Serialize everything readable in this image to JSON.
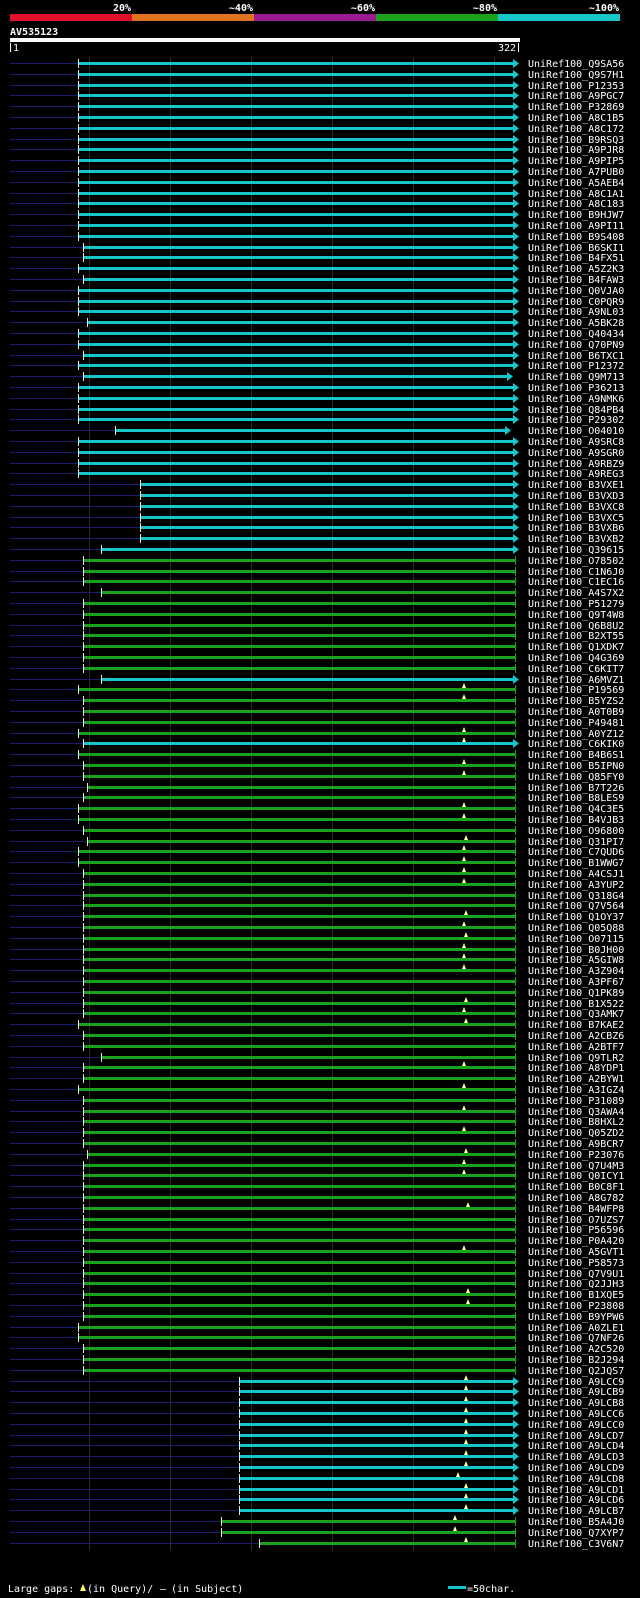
{
  "title": "AV535123",
  "scale": {
    "labels": [
      "20%",
      "~40%",
      "~60%",
      "~80%",
      "~100%"
    ],
    "colors": [
      "#e0102c",
      "#e2731e",
      "#9a1b8f",
      "#1ca11c",
      "#17c6c8"
    ]
  },
  "ruler": {
    "start": "1",
    "end": "322"
  },
  "legend": {
    "prefix": "Large gaps:",
    "query_text": "(in Query)/",
    "dash": "–",
    "subject_text": "(in Subject)",
    "scale_text": "=50char."
  },
  "colors": {
    "cyan": "#17c6c8",
    "green": "#1ca11c",
    "navy": "#1a1a6e",
    "gridline": "#2b2b2b",
    "white_bar": "#ffffff"
  },
  "hits": [
    {
      "id": "UniRef100_Q9SA56",
      "s": 78,
      "e": 516,
      "c": "cyan"
    },
    {
      "id": "UniRef100_Q9S7H1",
      "s": 78,
      "e": 516,
      "c": "cyan"
    },
    {
      "id": "UniRef100_P12353",
      "s": 78,
      "e": 516,
      "c": "cyan"
    },
    {
      "id": "UniRef100_A9PGC7",
      "s": 78,
      "e": 516,
      "c": "cyan"
    },
    {
      "id": "UniRef100_P32869",
      "s": 78,
      "e": 516,
      "c": "cyan"
    },
    {
      "id": "UniRef100_A8C1B5",
      "s": 78,
      "e": 516,
      "c": "cyan"
    },
    {
      "id": "UniRef100_A8C172",
      "s": 78,
      "e": 516,
      "c": "cyan"
    },
    {
      "id": "UniRef100_B9RSQ3",
      "s": 78,
      "e": 516,
      "c": "cyan"
    },
    {
      "id": "UniRef100_A9PJR8",
      "s": 78,
      "e": 516,
      "c": "cyan"
    },
    {
      "id": "UniRef100_A9PIP5",
      "s": 78,
      "e": 516,
      "c": "cyan"
    },
    {
      "id": "UniRef100_A7PUB0",
      "s": 78,
      "e": 516,
      "c": "cyan"
    },
    {
      "id": "UniRef100_A5AEB4",
      "s": 78,
      "e": 516,
      "c": "cyan"
    },
    {
      "id": "UniRef100_A8C1A1",
      "s": 78,
      "e": 516,
      "c": "cyan"
    },
    {
      "id": "UniRef100_A8C183",
      "s": 78,
      "e": 516,
      "c": "cyan"
    },
    {
      "id": "UniRef100_B9HJW7",
      "s": 78,
      "e": 516,
      "c": "cyan"
    },
    {
      "id": "UniRef100_A9PI11",
      "s": 78,
      "e": 516,
      "c": "cyan"
    },
    {
      "id": "UniRef100_B9S408",
      "s": 78,
      "e": 516,
      "c": "cyan"
    },
    {
      "id": "UniRef100_B6SKI1",
      "s": 83,
      "e": 516,
      "c": "cyan"
    },
    {
      "id": "UniRef100_B4FX51",
      "s": 83,
      "e": 516,
      "c": "cyan"
    },
    {
      "id": "UniRef100_A5Z2K3",
      "s": 78,
      "e": 516,
      "c": "cyan"
    },
    {
      "id": "UniRef100_B4FAW3",
      "s": 83,
      "e": 516,
      "c": "cyan"
    },
    {
      "id": "UniRef100_Q0VJA0",
      "s": 78,
      "e": 516,
      "c": "cyan"
    },
    {
      "id": "UniRef100_C0PQR9",
      "s": 78,
      "e": 516,
      "c": "cyan"
    },
    {
      "id": "UniRef100_A9NL03",
      "s": 78,
      "e": 516,
      "c": "cyan"
    },
    {
      "id": "UniRef100_A5BK28",
      "s": 87,
      "e": 516,
      "c": "cyan"
    },
    {
      "id": "UniRef100_Q40434",
      "s": 78,
      "e": 516,
      "c": "cyan"
    },
    {
      "id": "UniRef100_Q70PN9",
      "s": 78,
      "e": 516,
      "c": "cyan"
    },
    {
      "id": "UniRef100_B6TXC1",
      "s": 83,
      "e": 516,
      "c": "cyan"
    },
    {
      "id": "UniRef100_P12372",
      "s": 78,
      "e": 516,
      "c": "cyan"
    },
    {
      "id": "UniRef100_Q9M713",
      "s": 83,
      "e": 510,
      "c": "cyan"
    },
    {
      "id": "UniRef100_P36213",
      "s": 78,
      "e": 516,
      "c": "cyan"
    },
    {
      "id": "UniRef100_A9NMK6",
      "s": 78,
      "e": 516,
      "c": "cyan"
    },
    {
      "id": "UniRef100_Q84PB4",
      "s": 78,
      "e": 516,
      "c": "cyan"
    },
    {
      "id": "UniRef100_P29302",
      "s": 78,
      "e": 516,
      "c": "cyan"
    },
    {
      "id": "UniRef100_O04010",
      "s": 115,
      "e": 508,
      "c": "cyan"
    },
    {
      "id": "UniRef100_A9SRC8",
      "s": 78,
      "e": 516,
      "c": "cyan"
    },
    {
      "id": "UniRef100_A9SGR0",
      "s": 78,
      "e": 516,
      "c": "cyan"
    },
    {
      "id": "UniRef100_A9RBZ9",
      "s": 78,
      "e": 516,
      "c": "cyan"
    },
    {
      "id": "UniRef100_A9REG3",
      "s": 78,
      "e": 516,
      "c": "cyan"
    },
    {
      "id": "UniRef100_B3VXE1",
      "s": 140,
      "e": 516,
      "c": "cyan"
    },
    {
      "id": "UniRef100_B3VXD3",
      "s": 140,
      "e": 516,
      "c": "cyan"
    },
    {
      "id": "UniRef100_B3VXC8",
      "s": 140,
      "e": 516,
      "c": "cyan"
    },
    {
      "id": "UniRef100_B3VXC5",
      "s": 140,
      "e": 516,
      "c": "cyan"
    },
    {
      "id": "UniRef100_B3VXB6",
      "s": 140,
      "e": 516,
      "c": "cyan"
    },
    {
      "id": "UniRef100_B3VXB2",
      "s": 140,
      "e": 516,
      "c": "cyan"
    },
    {
      "id": "UniRef100_Q39615",
      "s": 101,
      "e": 516,
      "c": "cyan"
    },
    {
      "id": "UniRef100_O78502",
      "s": 83,
      "e": 516,
      "c": "green"
    },
    {
      "id": "UniRef100_C1N6J0",
      "s": 83,
      "e": 516,
      "c": "green"
    },
    {
      "id": "UniRef100_C1EC16",
      "s": 83,
      "e": 516,
      "c": "green"
    },
    {
      "id": "UniRef100_A4S7X2",
      "s": 101,
      "e": 516,
      "c": "green"
    },
    {
      "id": "UniRef100_P51279",
      "s": 83,
      "e": 516,
      "c": "green"
    },
    {
      "id": "UniRef100_Q9T4W8",
      "s": 83,
      "e": 516,
      "c": "green"
    },
    {
      "id": "UniRef100_Q6B8U2",
      "s": 83,
      "e": 516,
      "c": "green"
    },
    {
      "id": "UniRef100_B2XT55",
      "s": 83,
      "e": 516,
      "c": "green"
    },
    {
      "id": "UniRef100_Q1XDK7",
      "s": 83,
      "e": 516,
      "c": "green"
    },
    {
      "id": "UniRef100_Q4G369",
      "s": 83,
      "e": 516,
      "c": "green"
    },
    {
      "id": "UniRef100_C6KIT7",
      "s": 83,
      "e": 516,
      "c": "green"
    },
    {
      "id": "UniRef100_A6MVZ1",
      "s": 101,
      "e": 516,
      "c": "cyan"
    },
    {
      "id": "UniRef100_P19569",
      "s": 78,
      "e": 516,
      "c": "green",
      "gap": 464
    },
    {
      "id": "UniRef100_B5YZS2",
      "s": 83,
      "e": 516,
      "c": "green",
      "gap": 464
    },
    {
      "id": "UniRef100_A0T0B9",
      "s": 83,
      "e": 516,
      "c": "green"
    },
    {
      "id": "UniRef100_P49481",
      "s": 83,
      "e": 516,
      "c": "green"
    },
    {
      "id": "UniRef100_A0YZ12",
      "s": 78,
      "e": 516,
      "c": "green",
      "gap": 464
    },
    {
      "id": "UniRef100_C6KIK0",
      "s": 83,
      "e": 516,
      "c": "cyan",
      "gap": 464
    },
    {
      "id": "UniRef100_B4B6S1",
      "s": 78,
      "e": 516,
      "c": "green"
    },
    {
      "id": "UniRef100_B5IPN0",
      "s": 83,
      "e": 516,
      "c": "green",
      "gap": 464
    },
    {
      "id": "UniRef100_Q85FY0",
      "s": 83,
      "e": 516,
      "c": "green",
      "gap": 464
    },
    {
      "id": "UniRef100_B7T226",
      "s": 87,
      "e": 516,
      "c": "green"
    },
    {
      "id": "UniRef100_B8LES9",
      "s": 83,
      "e": 516,
      "c": "green"
    },
    {
      "id": "UniRef100_Q4C3E5",
      "s": 78,
      "e": 516,
      "c": "green",
      "gap": 464
    },
    {
      "id": "UniRef100_B4VJB3",
      "s": 78,
      "e": 516,
      "c": "green",
      "gap": 464
    },
    {
      "id": "UniRef100_O96800",
      "s": 83,
      "e": 516,
      "c": "green"
    },
    {
      "id": "UniRef100_Q31PI7",
      "s": 87,
      "e": 516,
      "c": "green",
      "gap": 466
    },
    {
      "id": "UniRef100_C7QUD6",
      "s": 78,
      "e": 516,
      "c": "green",
      "gap": 464
    },
    {
      "id": "UniRef100_B1WWG7",
      "s": 78,
      "e": 516,
      "c": "green",
      "gap": 464
    },
    {
      "id": "UniRef100_A4CSJ1",
      "s": 83,
      "e": 516,
      "c": "green",
      "gap": 464
    },
    {
      "id": "UniRef100_A3YUP2",
      "s": 83,
      "e": 516,
      "c": "green",
      "gap": 464
    },
    {
      "id": "UniRef100_Q318G4",
      "s": 83,
      "e": 516,
      "c": "green"
    },
    {
      "id": "UniRef100_Q7V564",
      "s": 83,
      "e": 516,
      "c": "green"
    },
    {
      "id": "UniRef100_Q1OY37",
      "s": 83,
      "e": 516,
      "c": "green",
      "gap": 466
    },
    {
      "id": "UniRef100_Q05Q88",
      "s": 83,
      "e": 516,
      "c": "green",
      "gap": 464
    },
    {
      "id": "UniRef100_O07115",
      "s": 83,
      "e": 516,
      "c": "green",
      "gap": 466
    },
    {
      "id": "UniRef100_B0JH00",
      "s": 83,
      "e": 516,
      "c": "green",
      "gap": 464
    },
    {
      "id": "UniRef100_A5GIW8",
      "s": 83,
      "e": 516,
      "c": "green",
      "gap": 464
    },
    {
      "id": "UniRef100_A3Z904",
      "s": 83,
      "e": 516,
      "c": "green",
      "gap": 464
    },
    {
      "id": "UniRef100_A3PF67",
      "s": 83,
      "e": 516,
      "c": "green"
    },
    {
      "id": "UniRef100_Q1PK89",
      "s": 83,
      "e": 516,
      "c": "green"
    },
    {
      "id": "UniRef100_B1X522",
      "s": 83,
      "e": 516,
      "c": "green",
      "gap": 466
    },
    {
      "id": "UniRef100_Q3AMK7",
      "s": 83,
      "e": 516,
      "c": "green",
      "gap": 464
    },
    {
      "id": "UniRef100_B7KAE2",
      "s": 78,
      "e": 516,
      "c": "green",
      "gap": 466
    },
    {
      "id": "UniRef100_A2CBZ6",
      "s": 83,
      "e": 516,
      "c": "green"
    },
    {
      "id": "UniRef100_A2BTF7",
      "s": 83,
      "e": 516,
      "c": "green"
    },
    {
      "id": "UniRef100_Q9TLR2",
      "s": 101,
      "e": 516,
      "c": "green"
    },
    {
      "id": "UniRef100_A8YDP1",
      "s": 83,
      "e": 516,
      "c": "green",
      "gap": 464
    },
    {
      "id": "UniRef100_A2BYW1",
      "s": 83,
      "e": 516,
      "c": "green"
    },
    {
      "id": "UniRef100_A3IGZ4",
      "s": 78,
      "e": 516,
      "c": "green",
      "gap": 464
    },
    {
      "id": "UniRef100_P31089",
      "s": 83,
      "e": 516,
      "c": "green"
    },
    {
      "id": "UniRef100_Q3AWA4",
      "s": 83,
      "e": 516,
      "c": "green",
      "gap": 464
    },
    {
      "id": "UniRef100_B8HXL2",
      "s": 83,
      "e": 516,
      "c": "green"
    },
    {
      "id": "UniRef100_Q05ZD2",
      "s": 83,
      "e": 516,
      "c": "green",
      "gap": 464
    },
    {
      "id": "UniRef100_A9BCR7",
      "s": 83,
      "e": 516,
      "c": "green"
    },
    {
      "id": "UniRef100_P23076",
      "s": 87,
      "e": 516,
      "c": "green",
      "gap": 466
    },
    {
      "id": "UniRef100_Q7U4M3",
      "s": 83,
      "e": 516,
      "c": "green",
      "gap": 464
    },
    {
      "id": "UniRef100_Q0ICY1",
      "s": 83,
      "e": 516,
      "c": "green",
      "gap": 464
    },
    {
      "id": "UniRef100_B0C8F1",
      "s": 83,
      "e": 516,
      "c": "green"
    },
    {
      "id": "UniRef100_A8G782",
      "s": 83,
      "e": 516,
      "c": "green"
    },
    {
      "id": "UniRef100_B4WFP8",
      "s": 83,
      "e": 516,
      "c": "green",
      "gap": 468
    },
    {
      "id": "UniRef100_O7UZS7",
      "s": 83,
      "e": 516,
      "c": "green"
    },
    {
      "id": "UniRef100_P56596",
      "s": 83,
      "e": 516,
      "c": "green"
    },
    {
      "id": "UniRef100_P0A420",
      "s": 83,
      "e": 516,
      "c": "green"
    },
    {
      "id": "UniRef100_A5GVT1",
      "s": 83,
      "e": 516,
      "c": "green",
      "gap": 464
    },
    {
      "id": "UniRef100_P58573",
      "s": 83,
      "e": 516,
      "c": "green"
    },
    {
      "id": "UniRef100_Q7V9U1",
      "s": 83,
      "e": 516,
      "c": "green"
    },
    {
      "id": "UniRef100_Q2JJH3",
      "s": 83,
      "e": 516,
      "c": "green"
    },
    {
      "id": "UniRef100_B1XQE5",
      "s": 83,
      "e": 516,
      "c": "green",
      "gap": 468
    },
    {
      "id": "UniRef100_P23808",
      "s": 83,
      "e": 516,
      "c": "green",
      "gap": 468
    },
    {
      "id": "UniRef100_B9YPW6",
      "s": 83,
      "e": 516,
      "c": "green"
    },
    {
      "id": "UniRef100_A0ZLE1",
      "s": 78,
      "e": 516,
      "c": "green"
    },
    {
      "id": "UniRef100_Q7NF26",
      "s": 78,
      "e": 516,
      "c": "green"
    },
    {
      "id": "UniRef100_A2C520",
      "s": 83,
      "e": 516,
      "c": "green"
    },
    {
      "id": "UniRef100_B2J294",
      "s": 83,
      "e": 516,
      "c": "green"
    },
    {
      "id": "UniRef100_Q2JQS7",
      "s": 83,
      "e": 516,
      "c": "green"
    },
    {
      "id": "UniRef100_A9LCC9",
      "s": 239,
      "e": 516,
      "c": "cyan",
      "gap": 466
    },
    {
      "id": "UniRef100_A9LCB9",
      "s": 239,
      "e": 516,
      "c": "cyan",
      "gap": 466
    },
    {
      "id": "UniRef100_A9LCB8",
      "s": 239,
      "e": 516,
      "c": "cyan",
      "gap": 466
    },
    {
      "id": "UniRef100_A9LCC6",
      "s": 239,
      "e": 516,
      "c": "cyan",
      "gap": 466
    },
    {
      "id": "UniRef100_A9LCC0",
      "s": 239,
      "e": 516,
      "c": "cyan",
      "gap": 466
    },
    {
      "id": "UniRef100_A9LCD7",
      "s": 239,
      "e": 516,
      "c": "cyan",
      "gap": 466
    },
    {
      "id": "UniRef100_A9LCD4",
      "s": 239,
      "e": 516,
      "c": "cyan",
      "gap": 466
    },
    {
      "id": "UniRef100_A9LCD3",
      "s": 239,
      "e": 516,
      "c": "cyan",
      "gap": 466
    },
    {
      "id": "UniRef100_A9LCD9",
      "s": 239,
      "e": 516,
      "c": "cyan",
      "gap": 466
    },
    {
      "id": "UniRef100_A9LCD8",
      "s": 239,
      "e": 516,
      "c": "cyan",
      "gap": 458
    },
    {
      "id": "UniRef100_A9LCD1",
      "s": 239,
      "e": 516,
      "c": "cyan",
      "gap": 466
    },
    {
      "id": "UniRef100_A9LCD6",
      "s": 239,
      "e": 516,
      "c": "cyan",
      "gap": 466
    },
    {
      "id": "UniRef100_A9LCB7",
      "s": 239,
      "e": 516,
      "c": "cyan",
      "gap": 466
    },
    {
      "id": "UniRef100_B5A4J0",
      "s": 221,
      "e": 516,
      "c": "green",
      "gap": 455
    },
    {
      "id": "UniRef100_Q7XYP7",
      "s": 221,
      "e": 516,
      "c": "green",
      "gap": 455
    },
    {
      "id": "UniRef100_C3V6N7",
      "s": 259,
      "e": 516,
      "c": "green",
      "gap": 466
    }
  ]
}
